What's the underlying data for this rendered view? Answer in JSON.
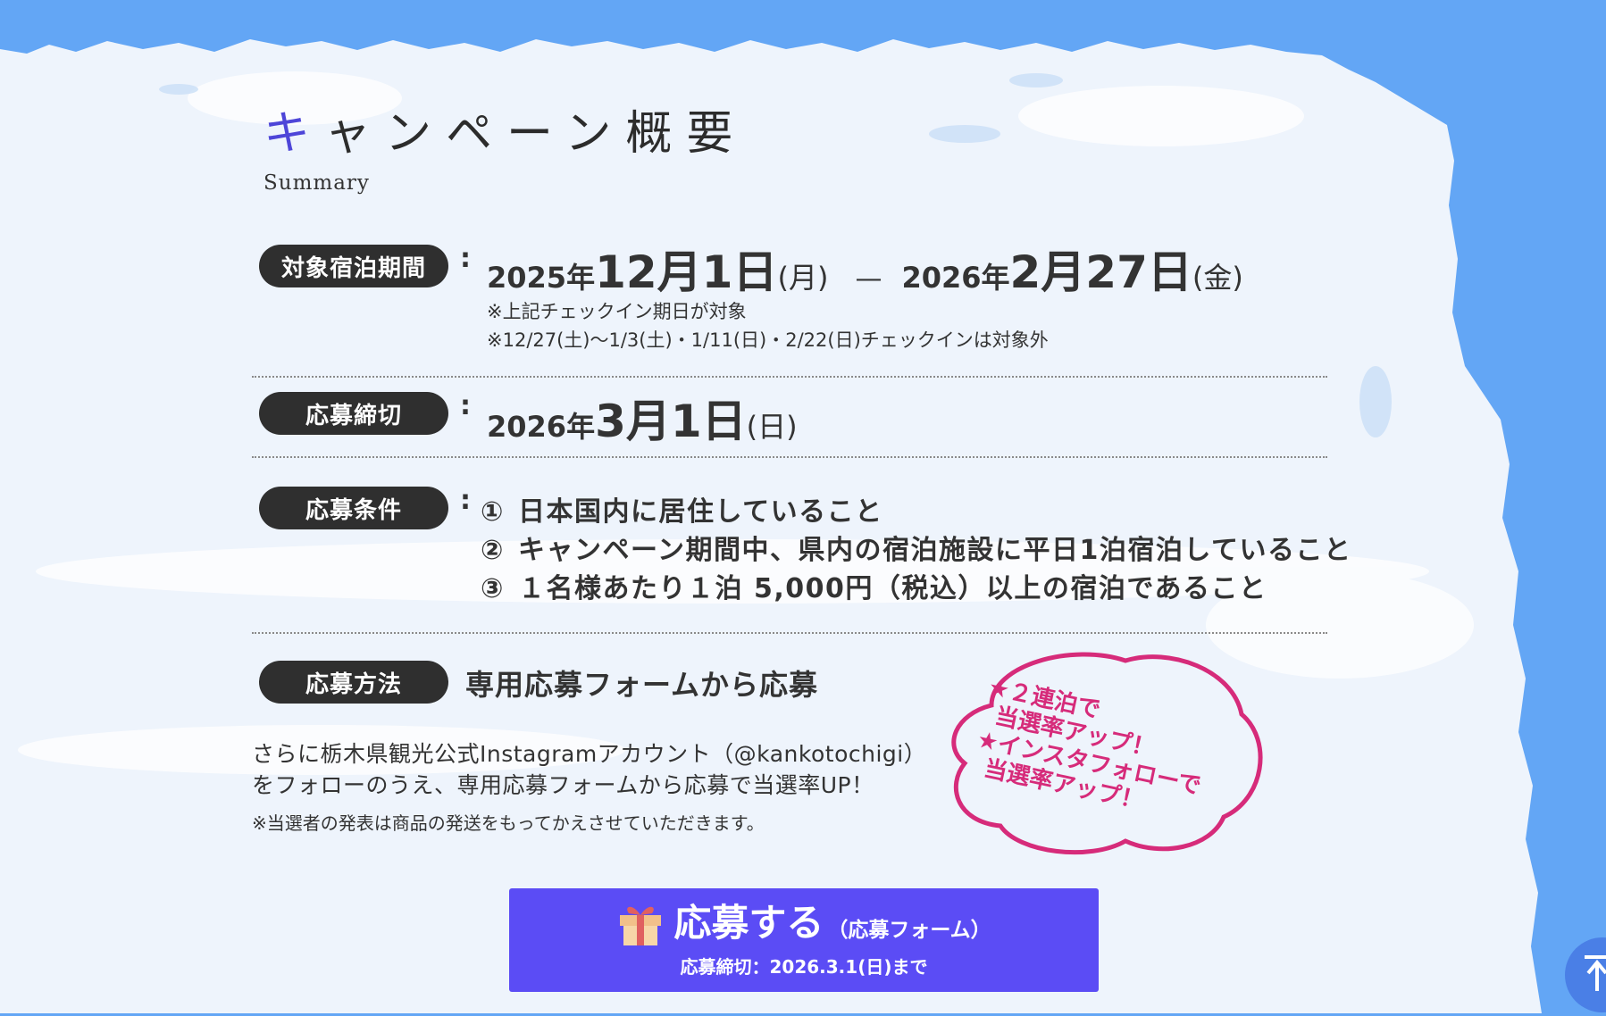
{
  "title": {
    "first_char": "キ",
    "rest": "ャンペーン概要",
    "subtitle": "Summary"
  },
  "period": {
    "label": "対象宿泊期間",
    "start_year": "2025年",
    "start_date": "12月1日",
    "start_dow": "(月)",
    "separator": "—",
    "end_year": "2026年",
    "end_date": "2月27日",
    "end_dow": "(金)",
    "note1": "※上記チェックイン期日が対象",
    "note2": "※12/27(土)〜1/3(土)・1/11(日)・2/22(日)チェックインは対象外"
  },
  "deadline": {
    "label": "応募締切",
    "year": "2026年",
    "date": "3月1日",
    "dow": "(日)"
  },
  "conditions": {
    "label": "応募条件",
    "items": [
      {
        "num": "①",
        "text": "日本国内に居住していること"
      },
      {
        "num": "②",
        "text": "キャンペーン期間中、県内の宿泊施設に平日1泊宿泊していること"
      },
      {
        "num": "③",
        "text": "１名様あたり１泊 5,000円（税込）以上の宿泊であること"
      }
    ]
  },
  "method": {
    "label": "応募方法",
    "text": "専用応募フォームから応募",
    "extra_line1": "さらに栃木県観光公式Instagramアカウント（@kankotochigi）",
    "extra_line2": "をフォローのうえ、専用応募フォームから応募で当選率UP！",
    "note": "※当選者の発表は商品の発送をもってかえさせていただきます。"
  },
  "bubble": {
    "lines": [
      "★２連泊で",
      "当選率アップ！",
      "★インスタフォローで",
      "当選率アップ！"
    ]
  },
  "cta": {
    "label": "応募する",
    "sub": "（応募フォーム）",
    "deadline": "応募締切：2026.3.1(日)まで",
    "icon": "gift-icon"
  },
  "colors": {
    "background": "#63a6f5",
    "accent": "#5b4cf5",
    "pill": "#2f2f2f",
    "bubble": "#d62b7a"
  }
}
